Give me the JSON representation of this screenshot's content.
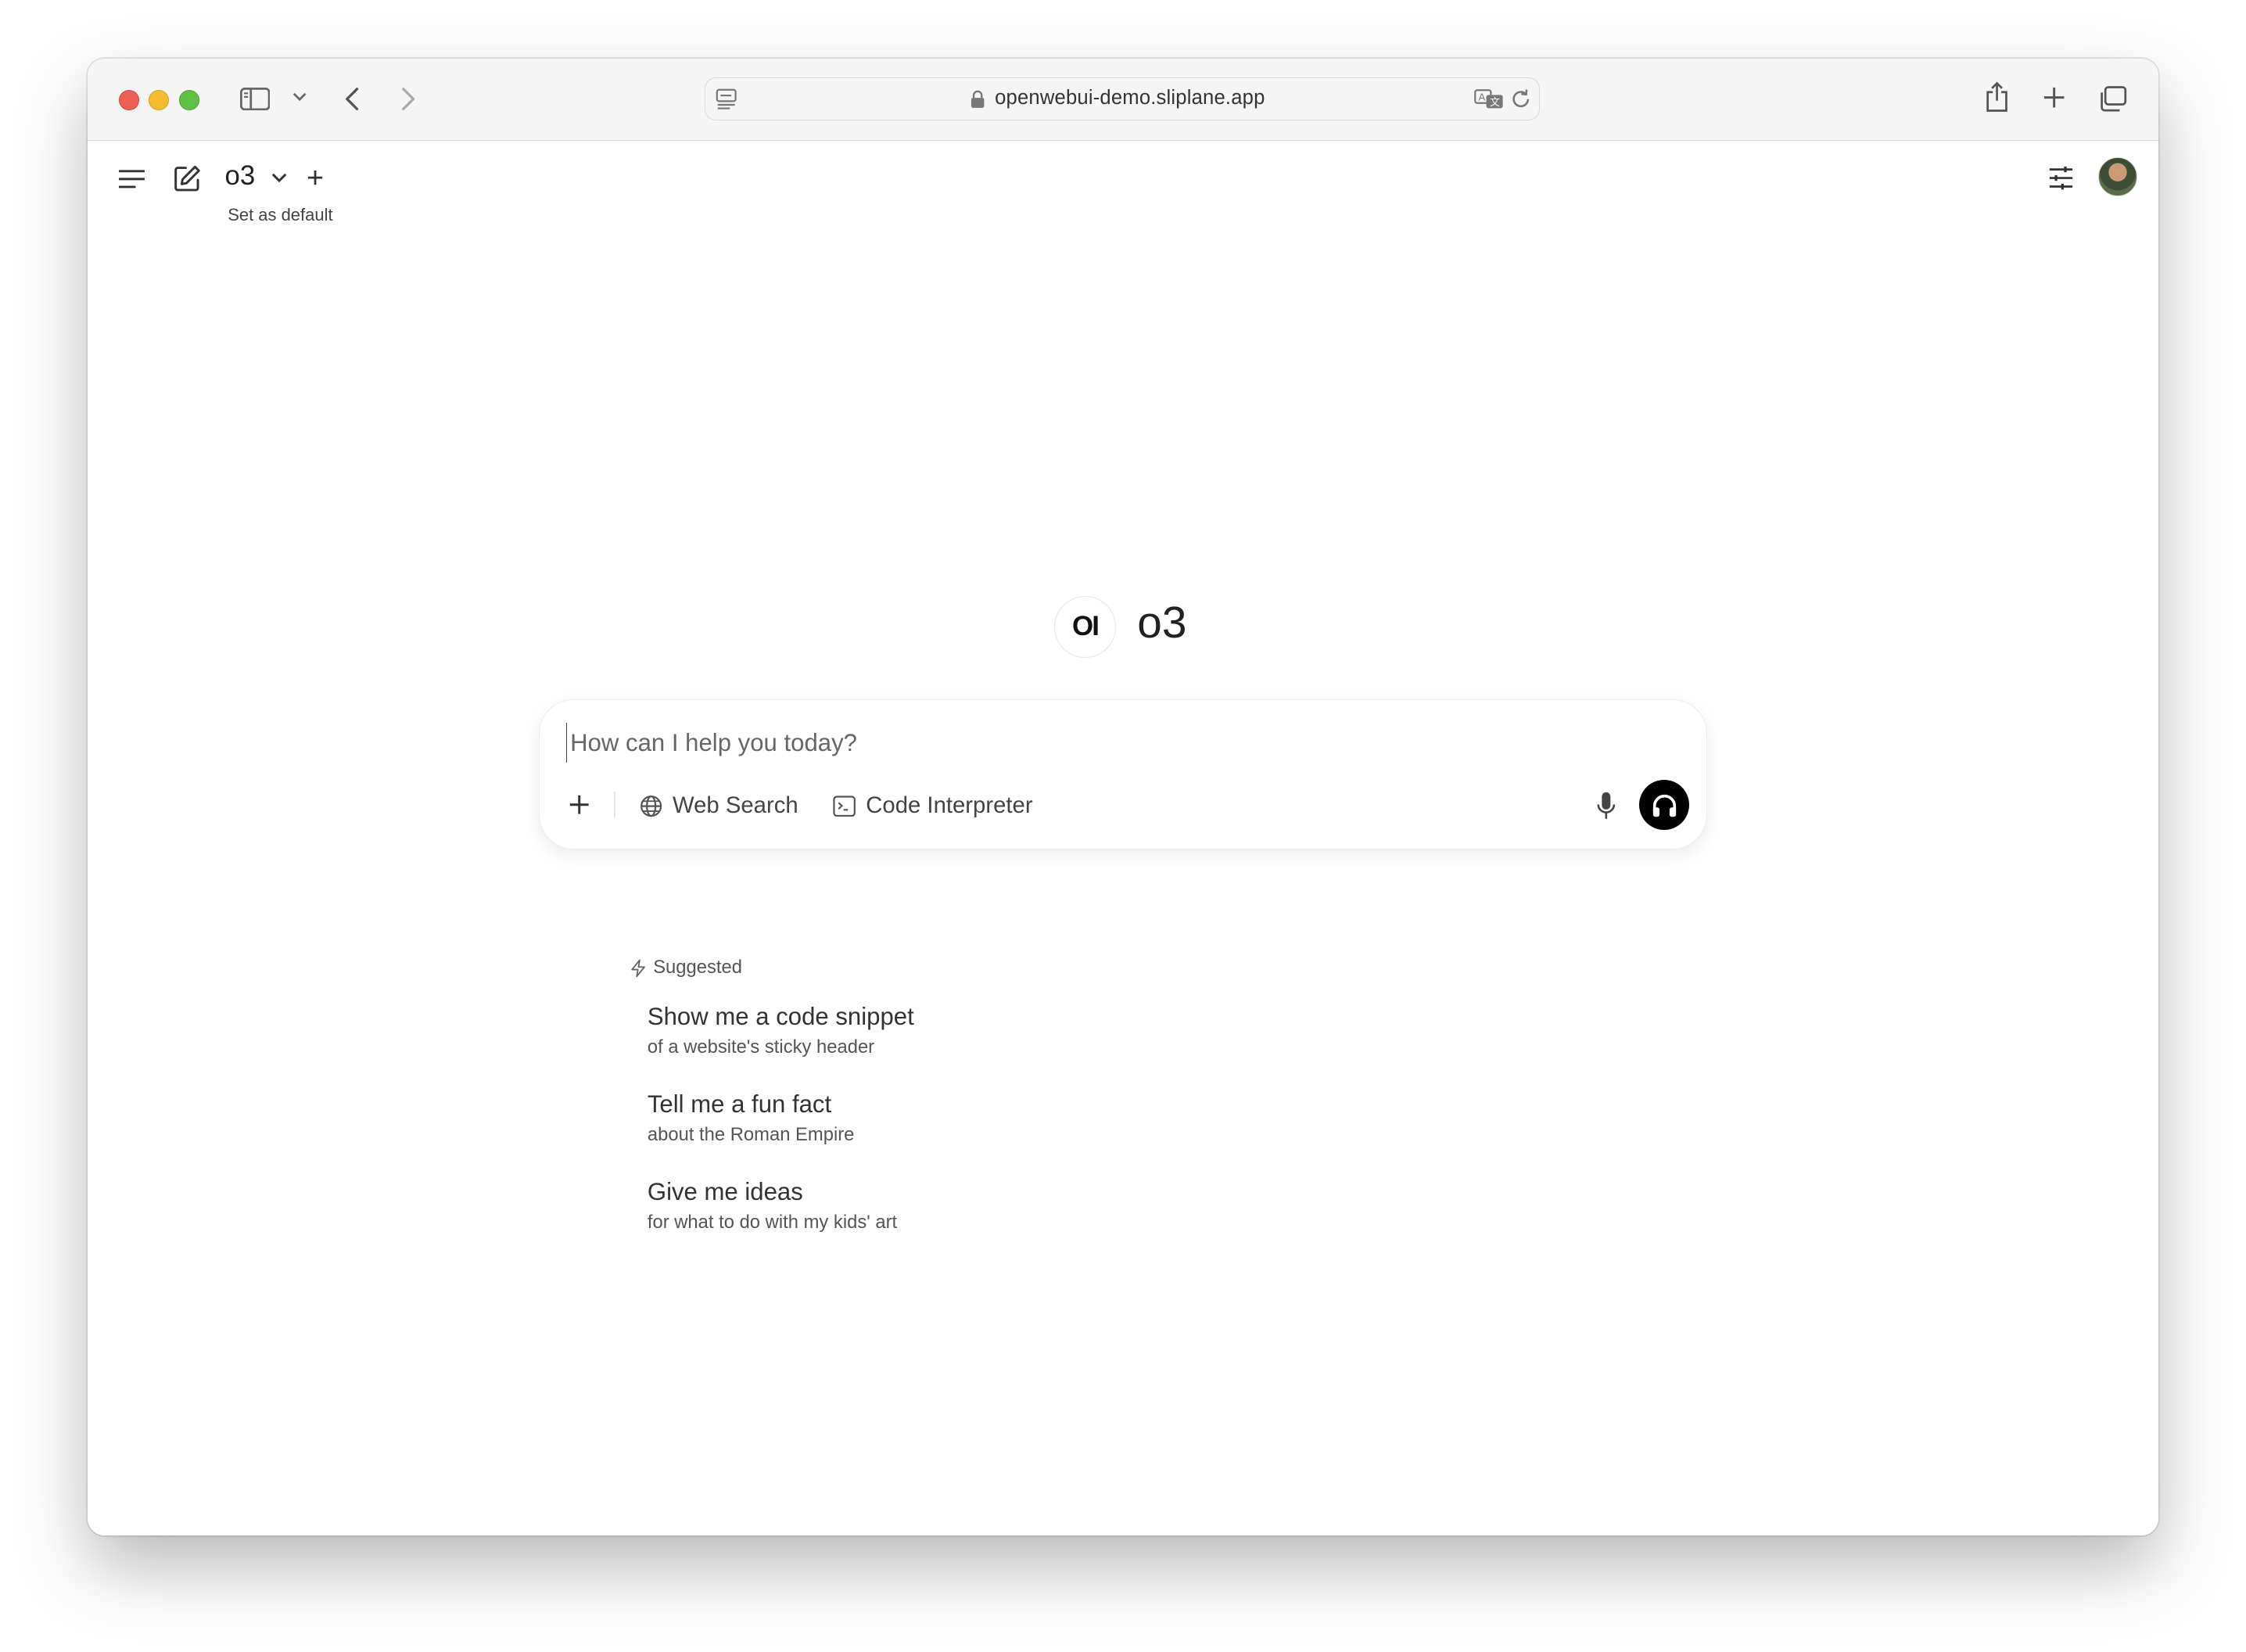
{
  "browser": {
    "url": "openwebui-demo.sliplane.app",
    "traffic_colors": {
      "close": "#ee5e57",
      "minimize": "#f4bc2f",
      "zoom": "#5fc242"
    }
  },
  "header": {
    "model": "o3",
    "set_default": "Set as default"
  },
  "hero": {
    "logo_text": "OI",
    "model_title": "o3"
  },
  "chat": {
    "placeholder": "How can I help you today?",
    "tools": {
      "web_search": "Web Search",
      "code_interpreter": "Code Interpreter"
    }
  },
  "suggestions": {
    "heading": "Suggested",
    "items": [
      {
        "title": "Show me a code snippet",
        "subtitle": "of a website's sticky header"
      },
      {
        "title": "Tell me a fun fact",
        "subtitle": "about the Roman Empire"
      },
      {
        "title": "Give me ideas",
        "subtitle": "for what to do with my kids' art"
      }
    ]
  },
  "icons": {
    "sidebar": "sidebar-icon",
    "back": "chevron-left-icon",
    "forward": "chevron-right-icon",
    "share": "share-icon",
    "new_tab": "plus-icon",
    "tabs": "tabs-overview-icon",
    "menu": "hamburger-icon",
    "new_chat": "edit-icon",
    "settings": "sliders-icon",
    "mic": "microphone-icon",
    "voice": "headphones-icon"
  }
}
